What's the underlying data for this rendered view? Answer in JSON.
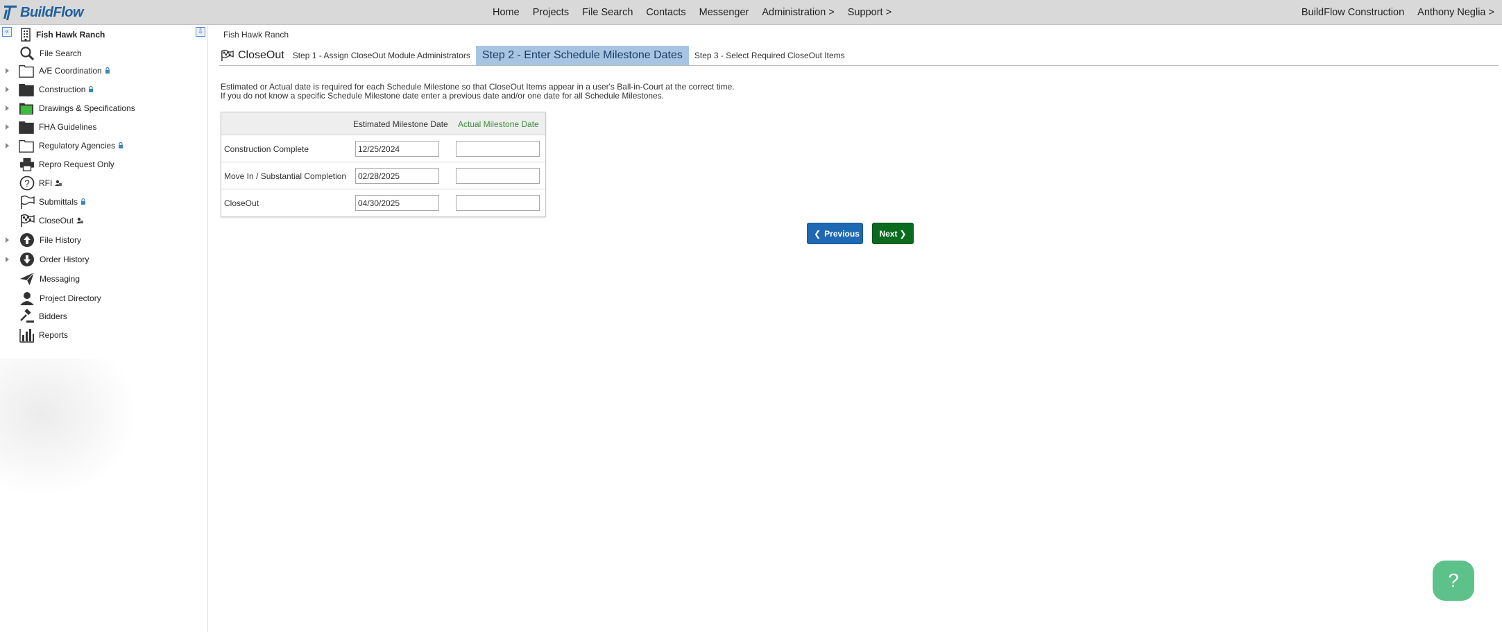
{
  "app": {
    "logo_text": "BuildFlow",
    "brand_color": "#1f5f9e"
  },
  "topnav": {
    "items": [
      "Home",
      "Projects",
      "File Search",
      "Contacts",
      "Messenger",
      "Administration >",
      "Support >"
    ],
    "company": "BuildFlow Construction",
    "user": "Anthony Neglia >"
  },
  "sidebar": {
    "project_name": "Fish Hawk Ranch",
    "items": [
      {
        "label": "File Search",
        "icon": "search-icon"
      },
      {
        "label": "A/E Coordination",
        "icon": "folder-outline-icon",
        "locked": true
      },
      {
        "label": "Construction",
        "icon": "folder-filled-icon",
        "locked": true
      },
      {
        "label": "Drawings & Specifications",
        "icon": "folder-green-icon"
      },
      {
        "label": "FHA Guidelines",
        "icon": "folder-filled-icon"
      },
      {
        "label": "Regulatory Agencies",
        "icon": "folder-outline-icon",
        "locked": true
      },
      {
        "label": "Repro Request Only",
        "icon": "printer-icon"
      },
      {
        "label": "RFI",
        "icon": "question-icon"
      },
      {
        "label": "Submittals",
        "icon": "flag-icon",
        "locked": true
      },
      {
        "label": "CloseOut",
        "icon": "checkered-flag-icon"
      },
      {
        "label": "File History",
        "icon": "up-arrow-icon"
      },
      {
        "label": "Order History",
        "icon": "down-arrow-icon"
      },
      {
        "label": "Messaging",
        "icon": "paper-plane-icon"
      },
      {
        "label": "Project Directory",
        "icon": "person-icon"
      },
      {
        "label": "Bidders",
        "icon": "gavel-icon"
      },
      {
        "label": "Reports",
        "icon": "bar-chart-icon"
      }
    ]
  },
  "main": {
    "breadcrumb": "Fish Hawk Ranch",
    "module_title": "CloseOut",
    "steps": [
      "Step 1 - Assign CloseOut Module Administrators",
      "Step 2 - Enter Schedule Milestone Dates",
      "Step 3 - Select Required CloseOut Items"
    ],
    "instructions_line1": "Estimated or Actual date is required for each Schedule Milestone so that CloseOut Items appear in a user's Ball-in-Court at the correct time.",
    "instructions_line2": "If you do not know a specific Schedule Milestone date enter a previous date and/or one date for all Schedule Milestones.",
    "table": {
      "col_estimated": "Estimated Milestone Date",
      "col_actual": "Actual Milestone Date",
      "rows": [
        {
          "label": "Construction Complete",
          "estimated": "12/25/2024",
          "actual": ""
        },
        {
          "label": "Move In / Substantial Completion",
          "estimated": "02/28/2025",
          "actual": ""
        },
        {
          "label": "CloseOut",
          "estimated": "04/30/2025",
          "actual": ""
        }
      ]
    },
    "previous_label": "Previous",
    "next_label": "Next",
    "help_symbol": "?"
  }
}
